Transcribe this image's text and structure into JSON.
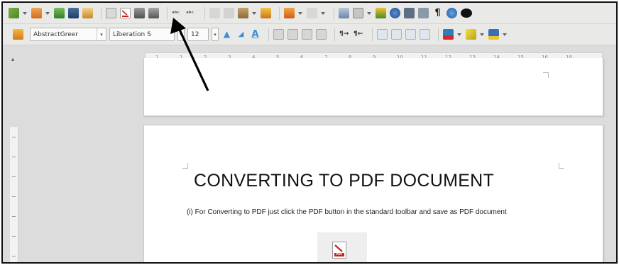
{
  "toolbar_standard": {
    "icons": [
      "new-icon",
      "open-icon",
      "save-icon",
      "email-icon",
      "edit-file-icon",
      "export-pdf-icon",
      "print-icon",
      "print-preview-icon",
      "spellcheck-icon",
      "autospell-icon",
      "cut-icon",
      "copy-icon",
      "paste-icon",
      "clone-formatting-icon",
      "undo-icon",
      "redo-icon",
      "hyperlink-icon",
      "table-icon",
      "chart-icon",
      "navigator-icon",
      "gallery-icon",
      "data-sources-icon",
      "formatting-marks-icon",
      "help-icon",
      "speech-bubble-icon"
    ],
    "colors": {
      "pdf_red": "#c0281f",
      "toolbar_bg": "#e9e9e7"
    }
  },
  "toolbar_formatting": {
    "paragraph_style": "AbstractGreer",
    "font_name": "Liberation S",
    "font_size": "12"
  },
  "document": {
    "title": "CONVERTING TO PDF DOCUMENT",
    "body": "(i) For Converting to PDF just click the PDF button in the standard toolbar  and save as PDF document",
    "pdf_icon_caption": "PDF"
  },
  "ruler": {
    "labels": [
      "1",
      "1",
      "2",
      "3",
      "4",
      "5",
      "6",
      "7",
      "8",
      "9",
      "10",
      "11",
      "12",
      "13",
      "14",
      "15",
      "16",
      "18"
    ]
  }
}
